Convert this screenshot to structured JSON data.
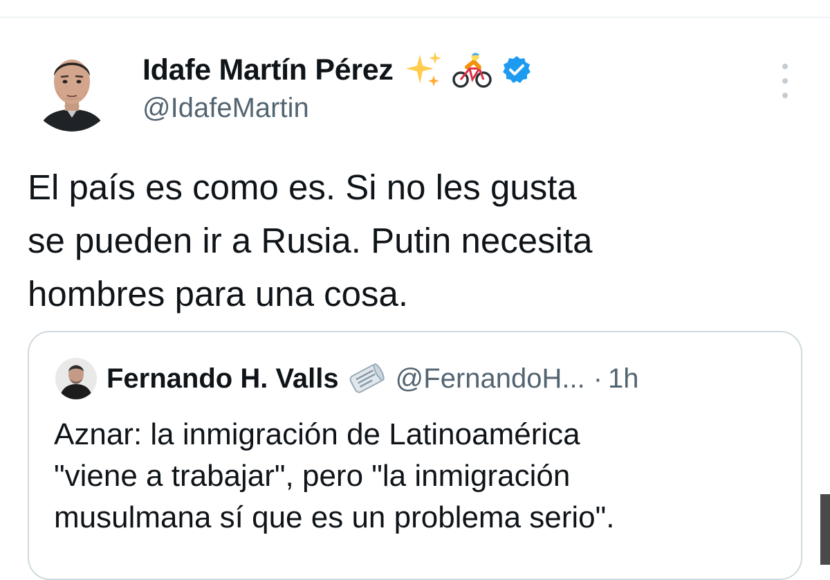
{
  "tweet": {
    "author": {
      "display_name": "Idafe Martín Pérez",
      "handle": "@IdafeMartin",
      "name_emojis": [
        "sparkles-icon",
        "person-biking-icon"
      ],
      "verified": true,
      "verified_color": "#1d9bf0"
    },
    "text": "El país es como es. Si no les gusta\nse pueden ir a Rusia. Putin necesita\nhombres para una cosa.",
    "menu_icon": "more-vertical-icon"
  },
  "quoted_tweet": {
    "author": {
      "display_name": "Fernando H. Valls",
      "name_emoji": "newspaper-icon",
      "handle": "@FernandoH...",
      "separator": "·",
      "time": "1h"
    },
    "text": "Aznar: la inmigración de Latinoamérica\n\"viene a trabajar\", pero \"la inmigración\nmusulmana sí que es un problema serio\"."
  },
  "colors": {
    "text_primary": "#0f1419",
    "text_secondary": "#536471",
    "border": "#cfd9de"
  }
}
